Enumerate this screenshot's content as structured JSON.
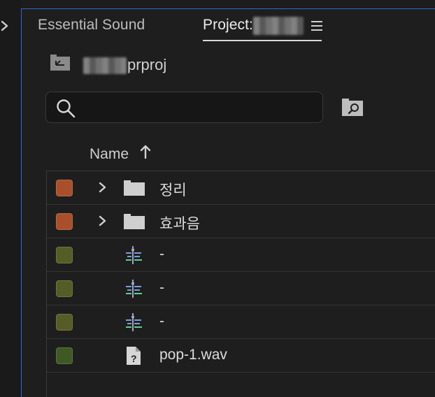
{
  "tabs": {
    "essential_sound": "Essential Sound",
    "project": "Project:"
  },
  "project_path": {
    "suffix": "prproj"
  },
  "search": {
    "value": "",
    "placeholder": ""
  },
  "columns": {
    "name": "Name",
    "sort": "ascending"
  },
  "items": [
    {
      "name": "정리",
      "type": "bin",
      "label_color": "#a9502a",
      "expandable": true
    },
    {
      "name": "효과음",
      "type": "bin",
      "label_color": "#a9502a",
      "expandable": true
    },
    {
      "name": "-",
      "type": "sequence",
      "label_color": "#565c25",
      "expandable": false
    },
    {
      "name": "-",
      "type": "sequence",
      "label_color": "#565c25",
      "expandable": false
    },
    {
      "name": "-",
      "type": "sequence",
      "label_color": "#565c25",
      "expandable": false
    },
    {
      "name": "pop-1.wav",
      "type": "missing-media",
      "label_color": "#3e5a22",
      "expandable": false
    }
  ],
  "colors": {
    "active_panel_border": "#2e67c7",
    "background": "#1e1e1e"
  }
}
